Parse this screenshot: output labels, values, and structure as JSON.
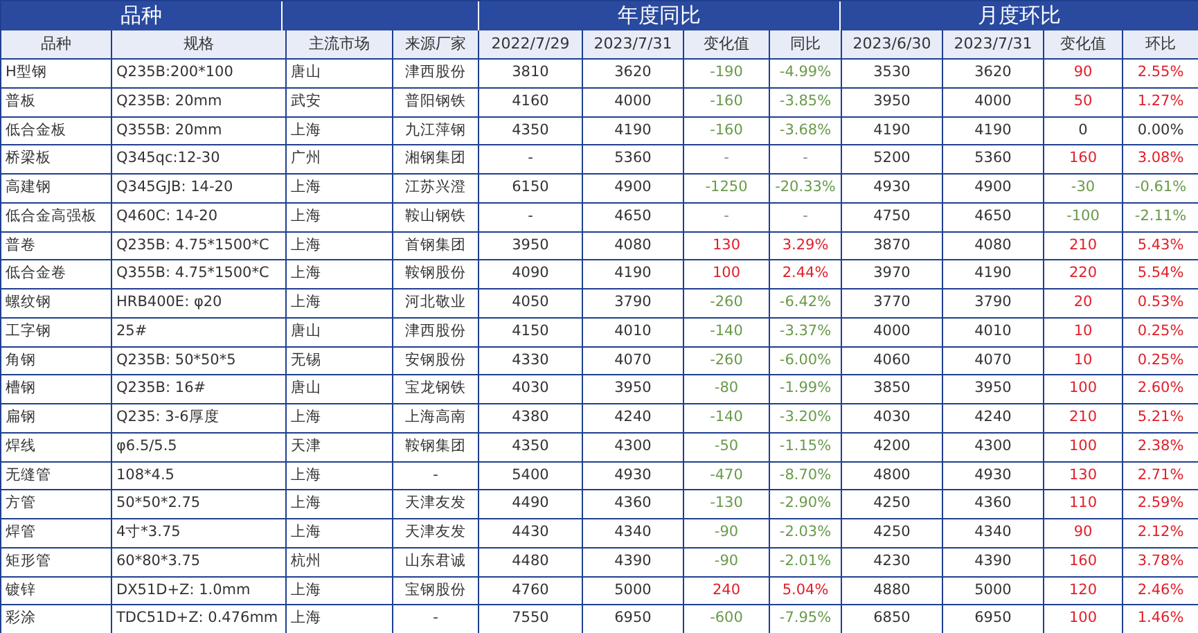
{
  "group_headers": [
    "品种",
    "年度同比",
    "月度环比"
  ],
  "columns": [
    "品种",
    "规格",
    "主流市场",
    "来源厂家",
    "2022/7/29",
    "2023/7/31",
    "变化值",
    "同比",
    "2023/6/30",
    "2023/7/31",
    "变化值",
    "环比"
  ],
  "rows": [
    {
      "name": "H型钢",
      "spec": "Q235B:200*100",
      "market": "唐山",
      "source": "津西股份",
      "y_prev": "3810",
      "y_cur": "3620",
      "yoy": {
        "change": "-190",
        "pct": "-4.99%",
        "color": "#6a9a4a"
      },
      "m_prev": "3530",
      "m_cur": "3620",
      "mom": {
        "change": "90",
        "pct": "2.55%",
        "color": "#e0202a"
      }
    },
    {
      "name": "普板",
      "spec": "Q235B: 20mm",
      "market": "武安",
      "source": "普阳钢铁",
      "y_prev": "4160",
      "y_cur": "4000",
      "yoy": {
        "change": "-160",
        "pct": "-3.85%",
        "color": "#6a9a4a"
      },
      "m_prev": "3950",
      "m_cur": "4000",
      "mom": {
        "change": "50",
        "pct": "1.27%",
        "color": "#e0202a"
      }
    },
    {
      "name": "低合金板",
      "spec": "Q355B: 20mm",
      "market": "上海",
      "source": "九江萍钢",
      "y_prev": "4350",
      "y_cur": "4190",
      "yoy": {
        "change": "-160",
        "pct": "-3.68%",
        "color": "#6a9a4a"
      },
      "m_prev": "4190",
      "m_cur": "4190",
      "mom": {
        "change": "0",
        "pct": "0.00%",
        "color": "#333333"
      }
    },
    {
      "name": "桥梁板",
      "spec": "Q345qc:12-30",
      "market": "广州",
      "source": "湘钢集团",
      "y_prev": "-",
      "y_cur": "5360",
      "yoy": {
        "change": "-",
        "pct": "-",
        "color": "#888888"
      },
      "m_prev": "5200",
      "m_cur": "5360",
      "mom": {
        "change": "160",
        "pct": "3.08%",
        "color": "#e0202a"
      }
    },
    {
      "name": "高建钢",
      "spec": "Q345GJB: 14-20",
      "market": "上海",
      "source": "江苏兴澄",
      "y_prev": "6150",
      "y_cur": "4900",
      "yoy": {
        "change": "-1250",
        "pct": "-20.33%",
        "color": "#6a9a4a"
      },
      "m_prev": "4930",
      "m_cur": "4900",
      "mom": {
        "change": "-30",
        "pct": "-0.61%",
        "color": "#6a9a4a"
      }
    },
    {
      "name": "低合金高强板",
      "spec": "Q460C: 14-20",
      "market": "上海",
      "source": "鞍山钢铁",
      "y_prev": "-",
      "y_cur": "4650",
      "yoy": {
        "change": "-",
        "pct": "-",
        "color": "#888888"
      },
      "m_prev": "4750",
      "m_cur": "4650",
      "mom": {
        "change": "-100",
        "pct": "-2.11%",
        "color": "#6a9a4a"
      }
    },
    {
      "name": "普卷",
      "spec": "Q235B: 4.75*1500*C",
      "market": "上海",
      "source": "首钢集团",
      "y_prev": "3950",
      "y_cur": "4080",
      "yoy": {
        "change": "130",
        "pct": "3.29%",
        "color": "#e0202a"
      },
      "m_prev": "3870",
      "m_cur": "4080",
      "mom": {
        "change": "210",
        "pct": "5.43%",
        "color": "#e0202a"
      }
    },
    {
      "name": "低合金卷",
      "spec": "Q355B: 4.75*1500*C",
      "market": "上海",
      "source": "鞍钢股份",
      "y_prev": "4090",
      "y_cur": "4190",
      "yoy": {
        "change": "100",
        "pct": "2.44%",
        "color": "#e0202a"
      },
      "m_prev": "3970",
      "m_cur": "4190",
      "mom": {
        "change": "220",
        "pct": "5.54%",
        "color": "#e0202a"
      }
    },
    {
      "name": "螺纹钢",
      "spec": "HRB400E: φ20",
      "market": "上海",
      "source": "河北敬业",
      "y_prev": "4050",
      "y_cur": "3790",
      "yoy": {
        "change": "-260",
        "pct": "-6.42%",
        "color": "#6a9a4a"
      },
      "m_prev": "3770",
      "m_cur": "3790",
      "mom": {
        "change": "20",
        "pct": "0.53%",
        "color": "#e0202a"
      }
    },
    {
      "name": "工字钢",
      "spec": "25#",
      "market": "唐山",
      "source": "津西股份",
      "y_prev": "4150",
      "y_cur": "4010",
      "yoy": {
        "change": "-140",
        "pct": "-3.37%",
        "color": "#6a9a4a"
      },
      "m_prev": "4000",
      "m_cur": "4010",
      "mom": {
        "change": "10",
        "pct": "0.25%",
        "color": "#e0202a"
      }
    },
    {
      "name": "角钢",
      "spec": "Q235B: 50*50*5",
      "market": "无锡",
      "source": "安钢股份",
      "y_prev": "4330",
      "y_cur": "4070",
      "yoy": {
        "change": "-260",
        "pct": "-6.00%",
        "color": "#6a9a4a"
      },
      "m_prev": "4060",
      "m_cur": "4070",
      "mom": {
        "change": "10",
        "pct": "0.25%",
        "color": "#e0202a"
      }
    },
    {
      "name": "槽钢",
      "spec": "Q235B: 16#",
      "market": "唐山",
      "source": "宝龙钢铁",
      "y_prev": "4030",
      "y_cur": "3950",
      "yoy": {
        "change": "-80",
        "pct": "-1.99%",
        "color": "#6a9a4a"
      },
      "m_prev": "3850",
      "m_cur": "3950",
      "mom": {
        "change": "100",
        "pct": "2.60%",
        "color": "#e0202a"
      }
    },
    {
      "name": "扁钢",
      "spec": "Q235: 3-6厚度",
      "market": "上海",
      "source": "上海高南",
      "y_prev": "4380",
      "y_cur": "4240",
      "yoy": {
        "change": "-140",
        "pct": "-3.20%",
        "color": "#6a9a4a"
      },
      "m_prev": "4030",
      "m_cur": "4240",
      "mom": {
        "change": "210",
        "pct": "5.21%",
        "color": "#e0202a"
      }
    },
    {
      "name": "焊线",
      "spec": "φ6.5/5.5",
      "market": "天津",
      "source": "鞍钢集团",
      "y_prev": "4350",
      "y_cur": "4300",
      "yoy": {
        "change": "-50",
        "pct": "-1.15%",
        "color": "#6a9a4a"
      },
      "m_prev": "4200",
      "m_cur": "4300",
      "mom": {
        "change": "100",
        "pct": "2.38%",
        "color": "#e0202a"
      }
    },
    {
      "name": "无缝管",
      "spec": "108*4.5",
      "market": "上海",
      "source": "-",
      "y_prev": "5400",
      "y_cur": "4930",
      "yoy": {
        "change": "-470",
        "pct": "-8.70%",
        "color": "#6a9a4a"
      },
      "m_prev": "4800",
      "m_cur": "4930",
      "mom": {
        "change": "130",
        "pct": "2.71%",
        "color": "#e0202a"
      }
    },
    {
      "name": "方管",
      "spec": "50*50*2.75",
      "market": "上海",
      "source": "天津友发",
      "y_prev": "4490",
      "y_cur": "4360",
      "yoy": {
        "change": "-130",
        "pct": "-2.90%",
        "color": "#6a9a4a"
      },
      "m_prev": "4250",
      "m_cur": "4360",
      "mom": {
        "change": "110",
        "pct": "2.59%",
        "color": "#e0202a"
      }
    },
    {
      "name": "焊管",
      "spec": "4寸*3.75",
      "market": "上海",
      "source": "天津友发",
      "y_prev": "4430",
      "y_cur": "4340",
      "yoy": {
        "change": "-90",
        "pct": "-2.03%",
        "color": "#6a9a4a"
      },
      "m_prev": "4250",
      "m_cur": "4340",
      "mom": {
        "change": "90",
        "pct": "2.12%",
        "color": "#e0202a"
      }
    },
    {
      "name": "矩形管",
      "spec": "60*80*3.75",
      "market": "杭州",
      "source": "山东君诚",
      "y_prev": "4480",
      "y_cur": "4390",
      "yoy": {
        "change": "-90",
        "pct": "-2.01%",
        "color": "#6a9a4a"
      },
      "m_prev": "4230",
      "m_cur": "4390",
      "mom": {
        "change": "160",
        "pct": "3.78%",
        "color": "#e0202a"
      }
    },
    {
      "name": "镀锌",
      "spec": "DX51D+Z: 1.0mm",
      "market": "上海",
      "source": "宝钢股份",
      "y_prev": "4760",
      "y_cur": "5000",
      "yoy": {
        "change": "240",
        "pct": "5.04%",
        "color": "#e0202a"
      },
      "m_prev": "4880",
      "m_cur": "5000",
      "mom": {
        "change": "120",
        "pct": "2.46%",
        "color": "#e0202a"
      }
    },
    {
      "name": "彩涂",
      "spec": "TDC51D+Z: 0.476mm",
      "market": "上海",
      "source": "-",
      "y_prev": "7550",
      "y_cur": "6950",
      "yoy": {
        "change": "-600",
        "pct": "-7.95%",
        "color": "#6a9a4a"
      },
      "m_prev": "6850",
      "m_cur": "6950",
      "mom": {
        "change": "100",
        "pct": "1.46%",
        "color": "#e0202a"
      }
    }
  ]
}
